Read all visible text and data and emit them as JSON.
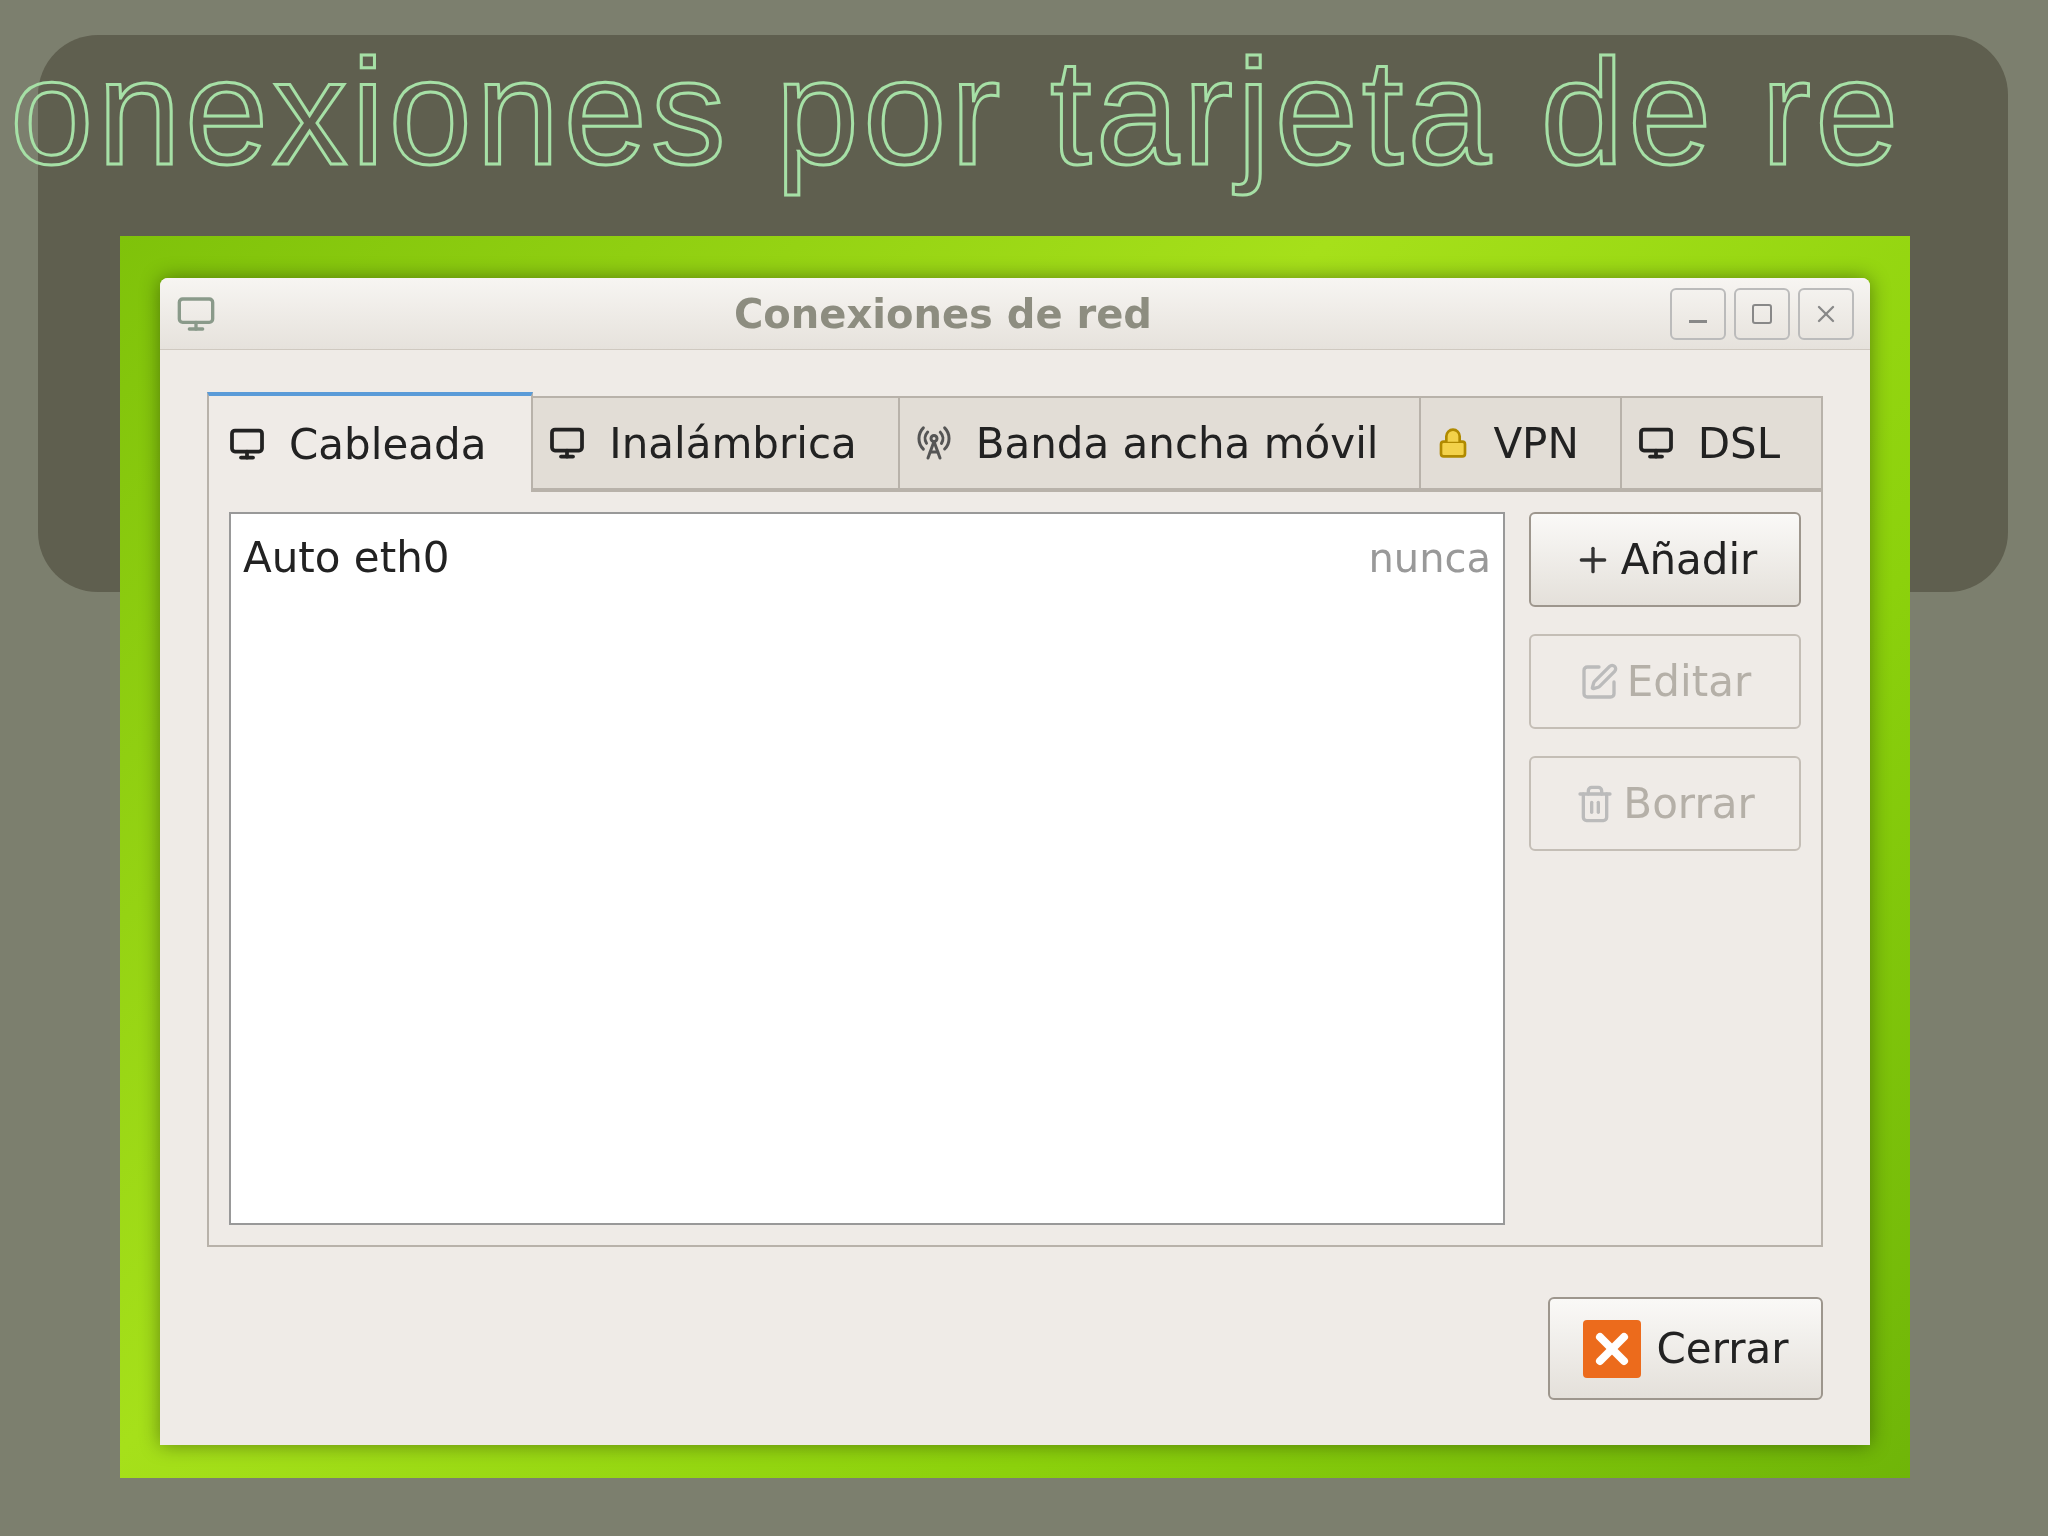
{
  "slide": {
    "title": "onexiones por tarjeta de re"
  },
  "window": {
    "title": "Conexiones de red"
  },
  "tabs": [
    {
      "label": "Cableada",
      "kind": "monitor",
      "selected": true
    },
    {
      "label": "Inalámbrica",
      "kind": "monitor",
      "selected": false
    },
    {
      "label": "Banda ancha móvil",
      "kind": "antenna",
      "selected": false
    },
    {
      "label": "VPN",
      "kind": "lock",
      "selected": false
    },
    {
      "label": "DSL",
      "kind": "monitor",
      "selected": false
    }
  ],
  "connections": [
    {
      "name": "Auto eth0",
      "last_used": "nunca"
    }
  ],
  "side_buttons": [
    {
      "label": "Añadir",
      "kind": "add",
      "disabled": false
    },
    {
      "label": "Editar",
      "kind": "edit",
      "disabled": true
    },
    {
      "label": "Borrar",
      "kind": "delete",
      "disabled": true
    }
  ],
  "close_button": {
    "label": "Cerrar"
  }
}
